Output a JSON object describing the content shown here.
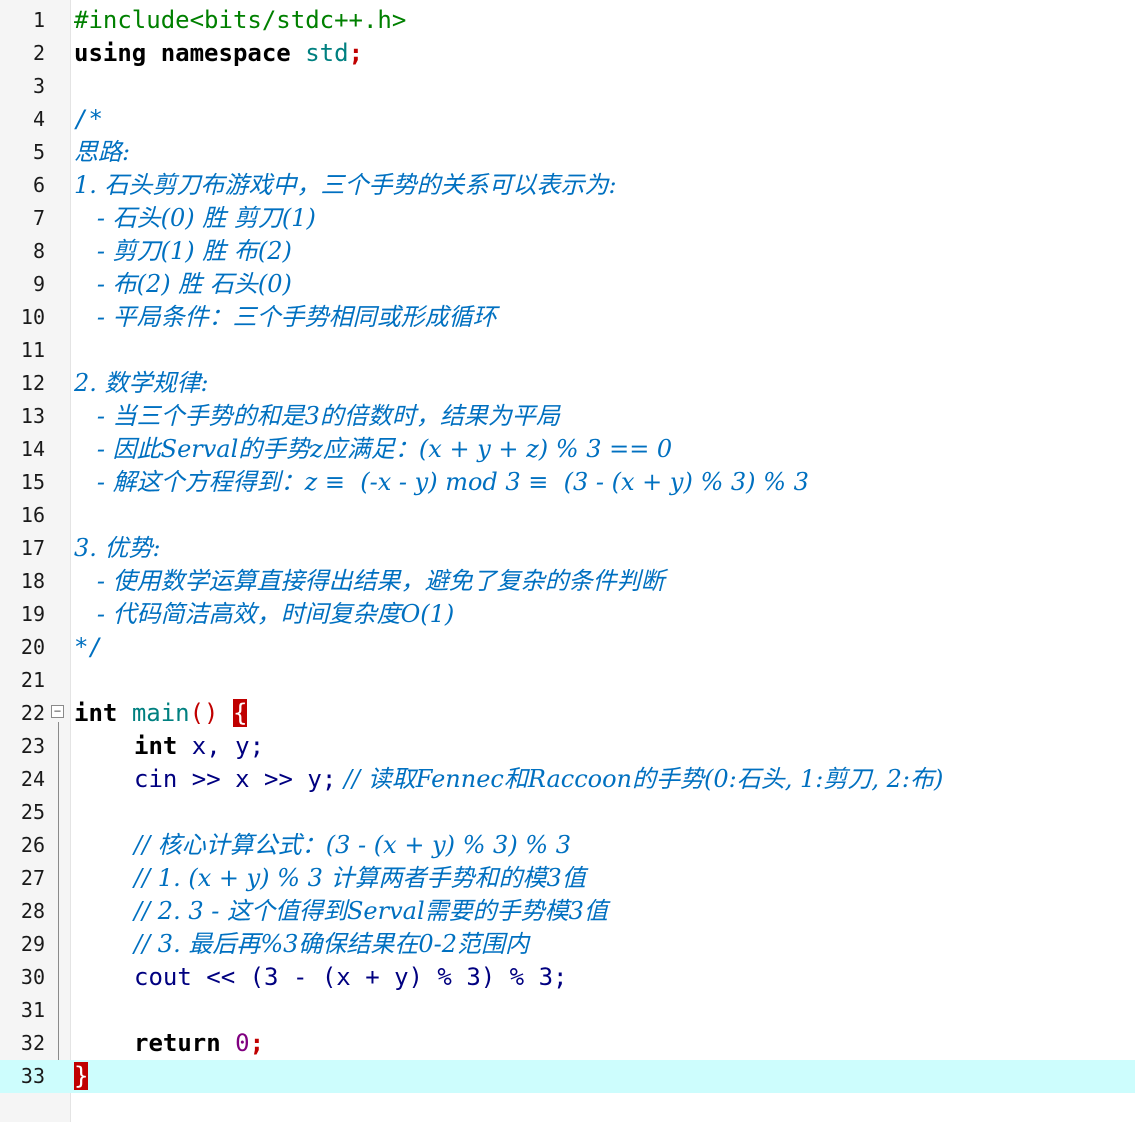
{
  "editor": {
    "current_line": 33,
    "lines": [
      {
        "n": "1",
        "text": "#include<bits/stdc++.h>"
      },
      {
        "n": "2",
        "kw": "using namespace",
        "ns": "std",
        "semi": ";"
      },
      {
        "n": "3",
        "text": ""
      },
      {
        "n": "4",
        "text": "/*"
      },
      {
        "n": "5",
        "text": "思路:"
      },
      {
        "n": "6",
        "text": "1. 石头剪刀布游戏中，三个手势的关系可以表示为:"
      },
      {
        "n": "7",
        "text": "   - 石头(0) 胜 剪刀(1)"
      },
      {
        "n": "8",
        "text": "   - 剪刀(1) 胜 布(2)"
      },
      {
        "n": "9",
        "text": "   - 布(2) 胜 石头(0)"
      },
      {
        "n": "10",
        "text": "   - 平局条件：三个手势相同或形成循环"
      },
      {
        "n": "11",
        "text": ""
      },
      {
        "n": "12",
        "text": "2. 数学规律:"
      },
      {
        "n": "13",
        "text": "   - 当三个手势的和是3的倍数时，结果为平局"
      },
      {
        "n": "14",
        "text": "   - 因此Serval的手势z应满足：(x + y + z) % 3 == 0"
      },
      {
        "n": "15",
        "text": "   - 解这个方程得到：z ≡  (-x - y) mod 3 ≡  (3 - (x + y) % 3) % 3"
      },
      {
        "n": "16",
        "text": ""
      },
      {
        "n": "17",
        "text": "3. 优势:"
      },
      {
        "n": "18",
        "text": "   - 使用数学运算直接得出结果，避免了复杂的条件判断"
      },
      {
        "n": "19",
        "text": "   - 代码简洁高效，时间复杂度O(1)"
      },
      {
        "n": "20",
        "text": "*/"
      },
      {
        "n": "21",
        "text": ""
      },
      {
        "n": "22",
        "kw": "int",
        "fn": "main",
        "parens": "()",
        "brace": "{"
      },
      {
        "n": "23",
        "kw": "int",
        "rest": " x, y;"
      },
      {
        "n": "24",
        "cin": "cin",
        "rest": " >> x >> y;",
        "comment": " // 读取Fennec和Raccoon的手势(0:石头, 1:剪刀, 2:布)"
      },
      {
        "n": "25",
        "text": ""
      },
      {
        "n": "26",
        "comment": "// 核心计算公式：(3 - (x + y) % 3) % 3"
      },
      {
        "n": "27",
        "comment": "// 1. (x + y) % 3 计算两者手势和的模3值"
      },
      {
        "n": "28",
        "comment": "// 2. 3 - 这个值得到Serval需要的手势模3值"
      },
      {
        "n": "29",
        "comment": "// 3. 最后再%3确保结果在0-2范围内"
      },
      {
        "n": "30",
        "cout": "cout",
        "rest": " << (3 - (x + y) % 3) % 3;"
      },
      {
        "n": "31",
        "text": ""
      },
      {
        "n": "32",
        "kw": "return",
        "num": "0",
        "semi": ";"
      },
      {
        "n": "33",
        "brace": "}"
      }
    ]
  }
}
